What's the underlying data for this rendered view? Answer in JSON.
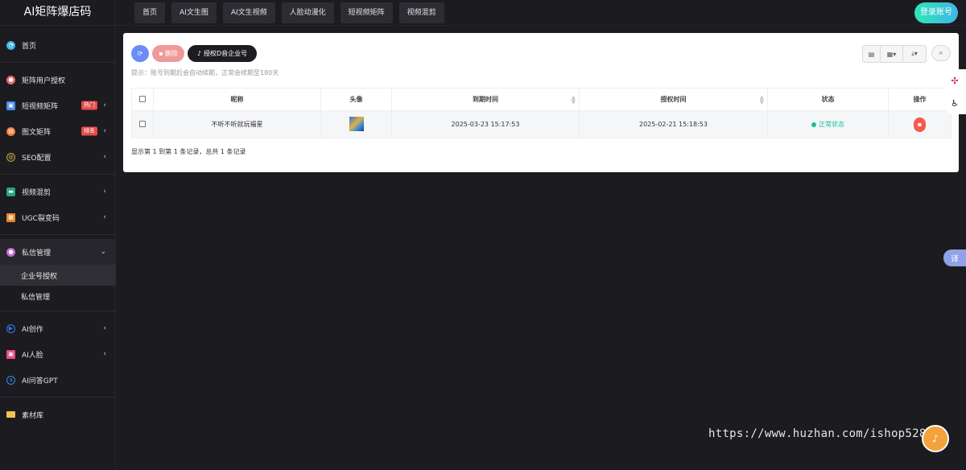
{
  "brand": "AI矩阵爆店码",
  "topnav": [
    "首页",
    "AI文生图",
    "AI文生视频",
    "人脸动漫化",
    "短视频矩阵",
    "视频混剪"
  ],
  "login_label": "登录账号",
  "sidebar": {
    "items": [
      {
        "label": "首页",
        "icon": "home-icon",
        "color": "#3fb6e8"
      },
      {
        "label": "矩阵用户授权",
        "icon": "user-auth-icon",
        "color": "#e66a6a"
      },
      {
        "label": "短视频矩阵",
        "icon": "video-matrix-icon",
        "color": "#4a8fe8",
        "badge": "热门",
        "arrow": "‹"
      },
      {
        "label": "图文矩阵",
        "icon": "image-text-icon",
        "color": "#f07a3a",
        "badge": "排名",
        "arrow": "‹"
      },
      {
        "label": "SEO配置",
        "icon": "seo-icon",
        "color": "#b8a23a",
        "arrow": "‹"
      },
      {
        "label": "视频混剪",
        "icon": "video-mix-icon",
        "color": "#2aa57a",
        "arrow": "‹"
      },
      {
        "label": "UGC裂变码",
        "icon": "qrcode-icon",
        "color": "#e8862a",
        "arrow": "‹"
      },
      {
        "label": "私信管理",
        "icon": "message-icon",
        "color": "#c86ad8",
        "arrow": "⌄"
      },
      {
        "label": "AI创作",
        "icon": "ai-create-icon",
        "color": "#3a7ae8",
        "arrow": "‹"
      },
      {
        "label": "AI人脸",
        "icon": "ai-face-icon",
        "color": "#e84a8a",
        "arrow": "‹"
      },
      {
        "label": "AI问答GPT",
        "icon": "ai-gpt-icon",
        "color": "#3a8ae8"
      },
      {
        "label": "素材库",
        "icon": "folder-icon",
        "color": "#f2c54a"
      }
    ],
    "sub_items": [
      "企业号授权",
      "私信管理"
    ]
  },
  "toolbar": {
    "delete_label": "删除",
    "auth_label": "授权D音企业号"
  },
  "hint": "提示：账号到期后会自动续期，正常会续期至180天",
  "table": {
    "headers": [
      "昵称",
      "头像",
      "到期时间",
      "授权时间",
      "状态",
      "操作"
    ],
    "rows": [
      {
        "nickname": "不听不听就玩福星",
        "expire": "2025-03-23 15:17:53",
        "auth_time": "2025-02-21 15:18:53",
        "status": "正常状态"
      }
    ]
  },
  "pager": "显示第 1 到第 1 条记录，总共 1 条记录",
  "translate_label": "译",
  "watermark": "https://www.huzhan.com/ishop52818"
}
